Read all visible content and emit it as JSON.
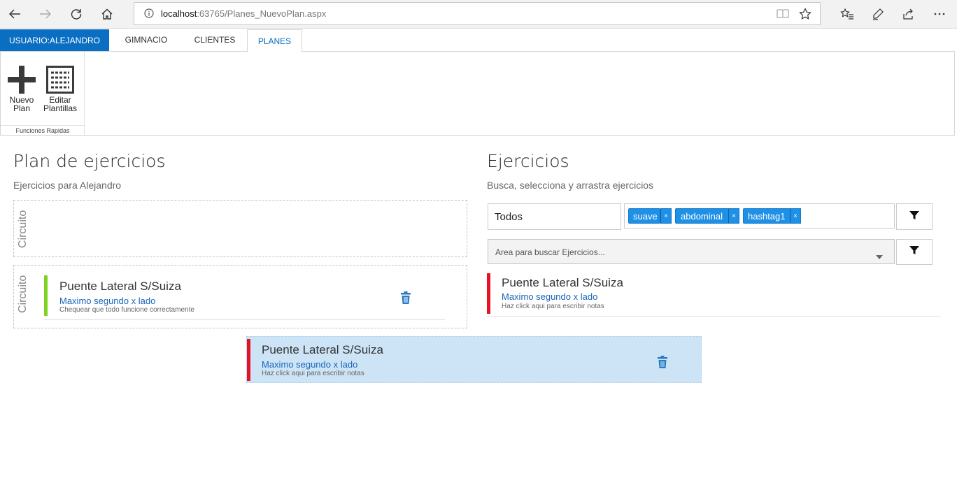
{
  "browser": {
    "url_host": "localhost",
    "url_path": ":63765/Planes_NuevoPlan.aspx"
  },
  "tabs": {
    "user": "USUARIO:ALEJANDRO",
    "items": [
      "GIMNACIO",
      "CLIENTES",
      "PLANES"
    ],
    "active": "PLANES"
  },
  "ribbon": {
    "new_plan_line1": "Nuevo",
    "new_plan_line2": "Plan",
    "edit_templates_line1": "Editar",
    "edit_templates_line2": "Plantillas",
    "group_label": "Funciones Rapidas"
  },
  "plan": {
    "title": "Plan de ejercicios",
    "subtitle": "Ejercicios para Alejandro",
    "circuit_label": "Circuito",
    "circuits": [
      {
        "label": "Circuito",
        "exercises": []
      },
      {
        "label": "Circuito",
        "exercises": [
          {
            "title": "Puente Lateral S/Suiza",
            "measure": "Maximo segundo x lado",
            "note": "Chequear que todo funcione correctamente",
            "color": "#7ed321"
          }
        ]
      }
    ]
  },
  "dragging": {
    "title": "Puente Lateral S/Suiza",
    "measure": "Maximo segundo x lado",
    "note": "Haz click aqui para escribir notas",
    "color": "#e81123"
  },
  "exercises": {
    "title": "Ejercicios",
    "subtitle": "Busca, selecciona y arrastra ejercicios",
    "category_value": "Todos",
    "tags": [
      {
        "label": "suave",
        "remove": "×"
      },
      {
        "label": "abdominal",
        "remove": "×"
      },
      {
        "label": "hashtag1",
        "remove": "×"
      }
    ],
    "search_placeholder": "Area para buscar Ejercicios...",
    "results": [
      {
        "title": "Puente Lateral S/Suiza",
        "measure": "Maximo segundo x lado",
        "note": "Haz click aqui para escribir notas",
        "color": "#e81123"
      }
    ]
  },
  "colors": {
    "accent": "#0a6fc2",
    "tag": "#1e90e6",
    "drag_bg": "#cce4f6",
    "green": "#7ed321",
    "red": "#e81123"
  }
}
